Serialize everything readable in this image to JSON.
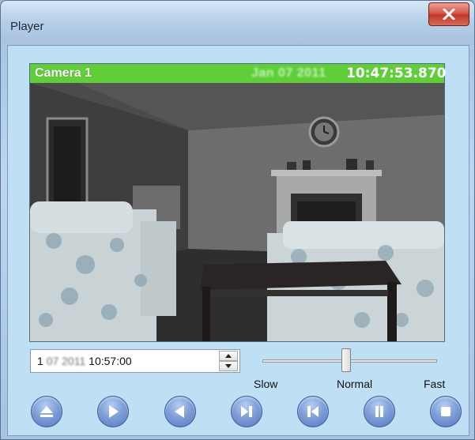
{
  "window": {
    "title": "Player",
    "close_icon": "close-x-icon"
  },
  "video": {
    "camera_name": "Camera 1",
    "date_blurred": "Jan 07 2011",
    "time": "10:47:53.870",
    "header_color": "#5fce39"
  },
  "date_field": {
    "prefix": "1 ",
    "date_blurred": "07 2011",
    "time": " 10:57:00"
  },
  "speed": {
    "slow_label": "Slow",
    "normal_label": "Normal",
    "fast_label": "Fast",
    "value_fraction": 0.48
  },
  "controls": [
    {
      "name": "eject-button",
      "icon": "eject-icon"
    },
    {
      "name": "play-button",
      "icon": "play-icon"
    },
    {
      "name": "reverse-play-button",
      "icon": "reverse-play-icon"
    },
    {
      "name": "step-forward-button",
      "icon": "step-forward-icon"
    },
    {
      "name": "step-back-button",
      "icon": "step-back-icon"
    },
    {
      "name": "pause-button",
      "icon": "pause-icon"
    },
    {
      "name": "stop-button",
      "icon": "stop-icon"
    }
  ]
}
